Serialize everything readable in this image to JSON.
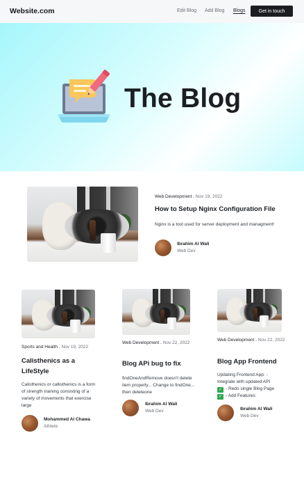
{
  "nav": {
    "brand": "Website.com",
    "links": [
      {
        "label": "Edit Blog"
      },
      {
        "label": "Add Blog"
      },
      {
        "label": "Blogs"
      }
    ],
    "cta": "Get in touch"
  },
  "hero": {
    "title": "The Blog",
    "illustration": "laptop-chat-pencil-illustration"
  },
  "featured": {
    "category": "Web Development",
    "date": "Nov 19, 2022",
    "title": "How to Setup Nginx Configuration File",
    "excerpt": "Nginx is a tool used for server deployment and managment!",
    "author": {
      "name": "Ibrahim Al Wali",
      "role": "Web Dev"
    }
  },
  "posts": [
    {
      "category": "Sports and Health",
      "date": "Nov 19, 2022",
      "title": "Calisthenics as a LifeStyle",
      "excerpt": "Calisthenics or callisthenics is a form of strength training consisting of a variety of movements that exercise large",
      "author": {
        "name": "Mohammed Al Chawa",
        "role": "Athlete"
      }
    },
    {
      "category": "Web Development",
      "date": "Nov 22, 2022",
      "title": "Blog APi bug to fix",
      "excerpt": "findOneAndRemove doesn't delete item properly... Change to findOne... then deleteone",
      "author": {
        "name": "Ibrahim Al Wali",
        "role": "Web Dev"
      }
    },
    {
      "category": "Web Development",
      "date": "Nov 22, 2022",
      "title": "Blog App Frontend",
      "excerpt_intro": "Updating Frontend App: - Integrate with updated API",
      "checklist": [
        "- Redo single Blog Page",
        "- Add Features:"
      ],
      "author": {
        "name": "Ibrahim Al Wali",
        "role": "Web Dev"
      }
    }
  ],
  "colors": {
    "hero_gradient_start": "#a6f6fb",
    "cta_bg": "#1c1d21",
    "check_green": "#2fa84f"
  }
}
